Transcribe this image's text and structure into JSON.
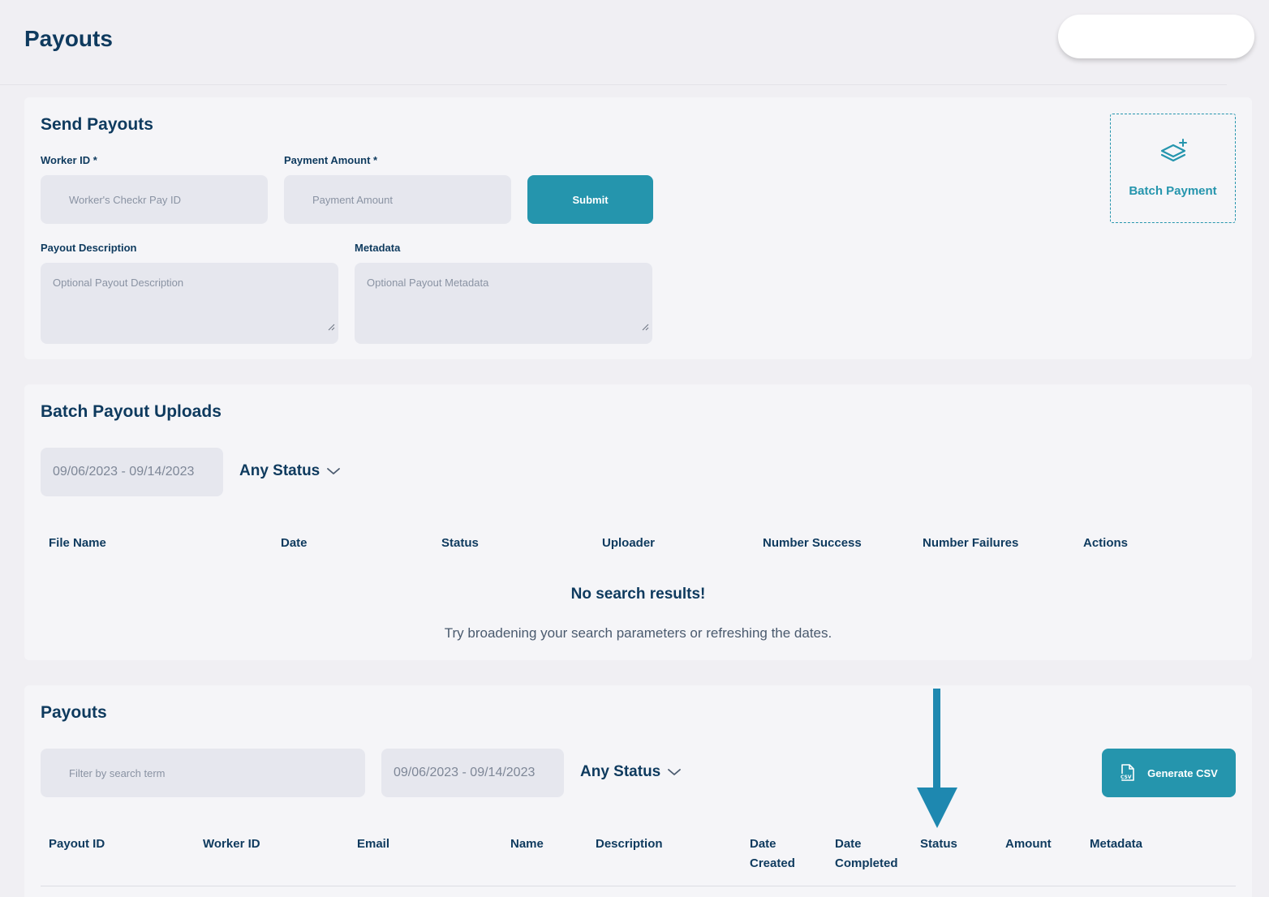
{
  "page": {
    "title": "Payouts"
  },
  "send": {
    "title": "Send Payouts",
    "worker_label": "Worker ID *",
    "worker_placeholder": "Worker's Checkr Pay ID",
    "amount_label": "Payment Amount *",
    "amount_placeholder": "Payment Amount",
    "submit": "Submit",
    "desc_label": "Payout Description",
    "desc_placeholder": "Optional Payout Description",
    "meta_label": "Metadata",
    "meta_placeholder": "Optional Payout Metadata",
    "batch_label": "Batch Payment"
  },
  "batch": {
    "title": "Batch Payout Uploads",
    "date_range": "09/06/2023 - 09/14/2023",
    "status": "Any Status",
    "columns": [
      "File Name",
      "Date",
      "Status",
      "Uploader",
      "Number Success",
      "Number Failures",
      "Actions"
    ],
    "empty_title": "No search results!",
    "empty_sub": "Try broadening your search parameters or refreshing the dates."
  },
  "payouts": {
    "title": "Payouts",
    "search_placeholder": "Filter by search term",
    "date_range": "09/06/2023 - 09/14/2023",
    "status": "Any Status",
    "csv_button": "Generate CSV",
    "columns": [
      "Payout ID",
      "Worker ID",
      "Email",
      "Name",
      "Description",
      "Date\nCreated",
      "Date\nCompleted",
      "Status",
      "Amount",
      "Metadata"
    ]
  },
  "colors": {
    "accent": "#2595ad",
    "navy": "#0e3a5e",
    "field": "#e6e7ee"
  },
  "icons": [
    "layers-plus-icon",
    "chevron-down-icon",
    "csv-file-icon",
    "arrow-down-icon",
    "resize-grip-icon"
  ]
}
